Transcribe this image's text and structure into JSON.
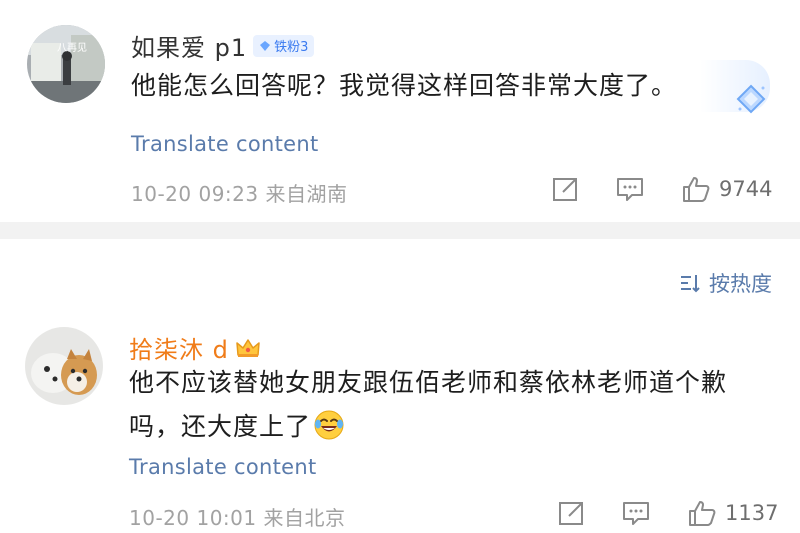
{
  "comments": [
    {
      "username": "如果爱 p1",
      "fan_badge": "铁粉3",
      "text": "他能怎么回答呢？我觉得这样回答非常大度了。",
      "translate_label": "Translate content",
      "meta": "10-20 09:23  来自湖南",
      "likes": "9744",
      "avatar_text": "八再见",
      "avatar_icon": "photo-avatar"
    },
    {
      "username": "拾柒沐 d",
      "badge_icon": "crown-icon",
      "text": "他不应该替她女朋友跟伍佰老师和蔡依林老师道个歉吗，还大度上了",
      "emoji_icon": "laughing-tears-emoji",
      "translate_label": "Translate content",
      "meta": "10-20 10:01  来自北京",
      "likes": "1137",
      "avatar_icon": "dog-avatar"
    }
  ],
  "sort": {
    "label": "按热度",
    "icon": "sort-icon"
  },
  "colors": {
    "link": "#5a7bab",
    "vip_name": "#f07c19",
    "meta": "#a2a2a2",
    "divider": "#f2f2f2"
  }
}
